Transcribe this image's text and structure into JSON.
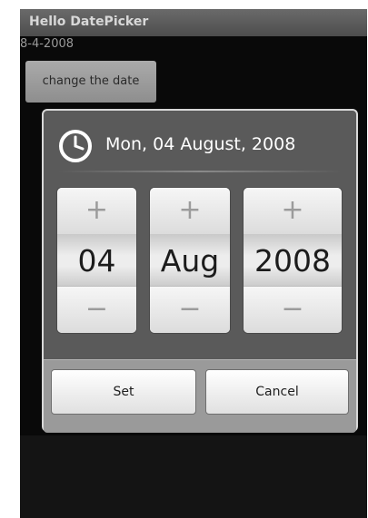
{
  "app": {
    "title": "Hello DatePicker",
    "date_text": "8-4-2008",
    "change_button_label": "change the date"
  },
  "dialog": {
    "title": "Mon, 04 August, 2008",
    "icon": "clock-icon",
    "spinners": [
      {
        "name": "day",
        "value": "04",
        "increment": "+",
        "decrement": "−"
      },
      {
        "name": "month",
        "value": "Aug",
        "increment": "+",
        "decrement": "−"
      },
      {
        "name": "year",
        "value": "2008",
        "increment": "+",
        "decrement": "−"
      }
    ],
    "set_label": "Set",
    "cancel_label": "Cancel"
  },
  "colors": {
    "screen_bg": "#090909",
    "dialog_bg": "#5a5a5a",
    "button_bar_bg": "#9a9a9a"
  }
}
